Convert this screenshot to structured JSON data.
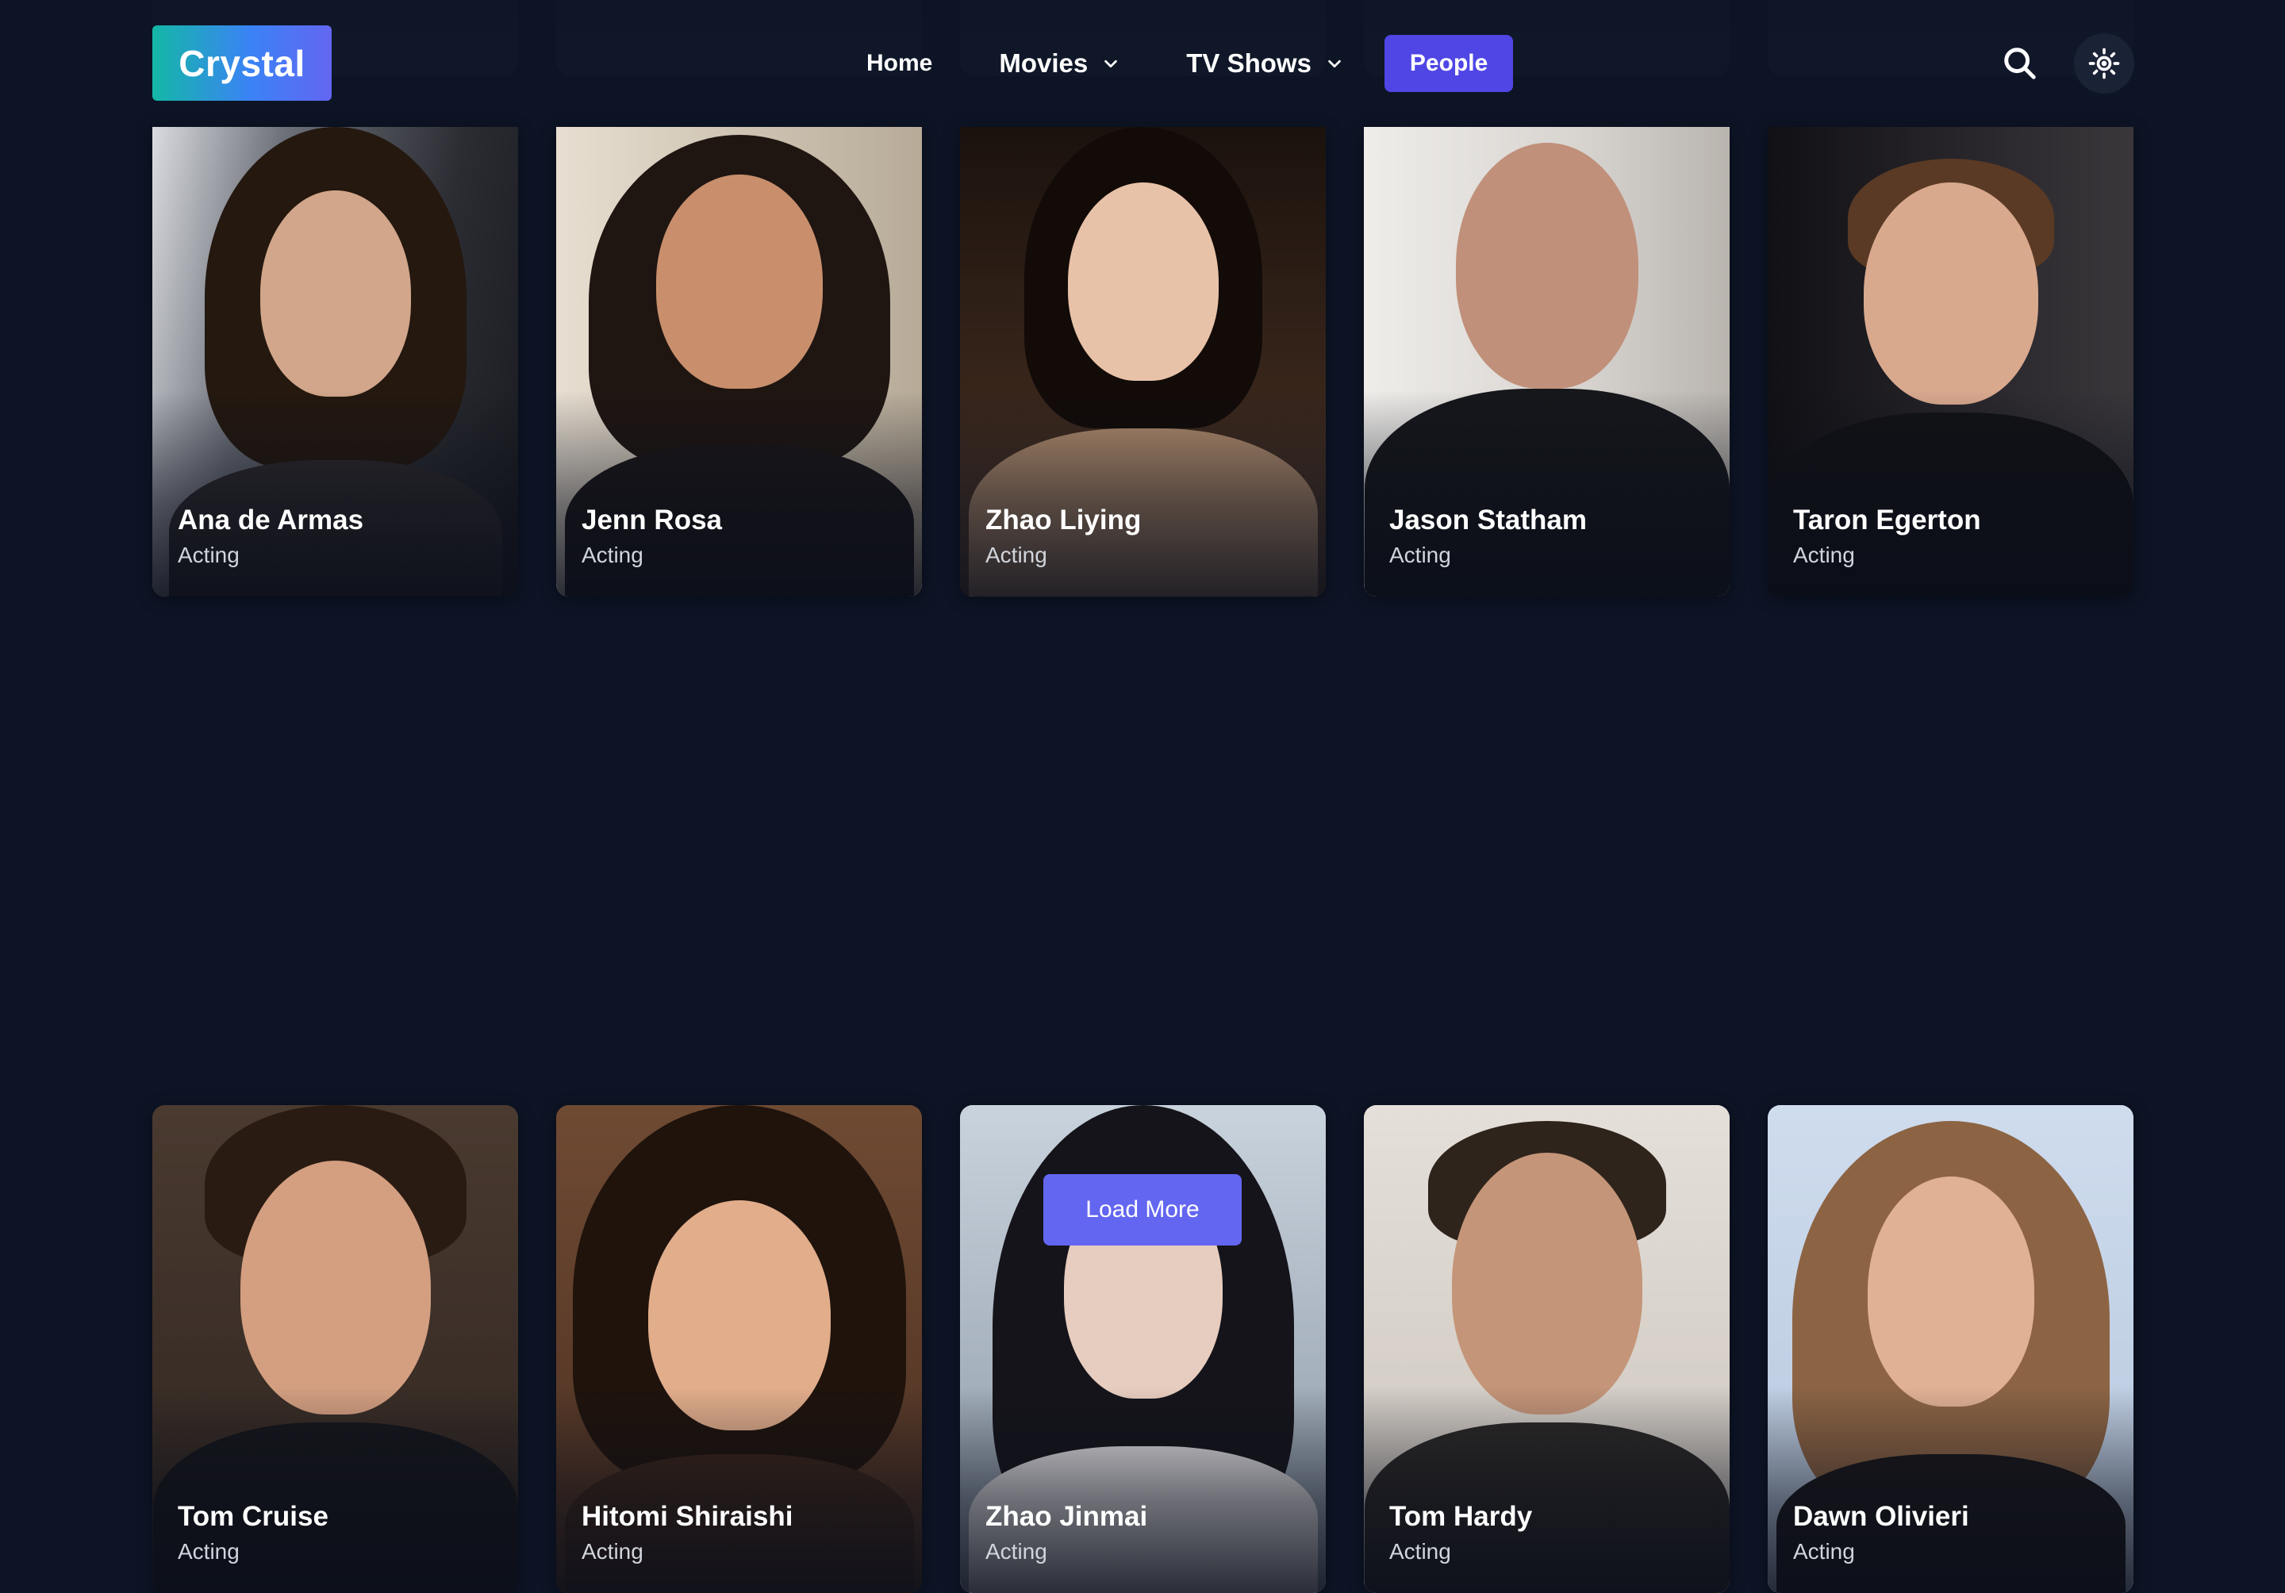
{
  "brand": {
    "logo_text": "Crystal"
  },
  "nav": {
    "home": "Home",
    "movies": "Movies",
    "tv_shows": "TV Shows",
    "people": "People",
    "active": "People"
  },
  "colors": {
    "background": "#0d1425",
    "accent": "#4f46e5",
    "button": "#6366f1"
  },
  "icons": {
    "search": "search-icon",
    "theme": "sun-icon",
    "chevron": "chevron-down-icon"
  },
  "people": [
    {
      "name": "Ana de Armas",
      "department": "Acting"
    },
    {
      "name": "Jenn Rosa",
      "department": "Acting"
    },
    {
      "name": "Zhao Liying",
      "department": "Acting"
    },
    {
      "name": "Jason Statham",
      "department": "Acting"
    },
    {
      "name": "Taron Egerton",
      "department": "Acting"
    },
    {
      "name": "Tom Cruise",
      "department": "Acting"
    },
    {
      "name": "Hitomi Shiraishi",
      "department": "Acting"
    },
    {
      "name": "Zhao Jinmai",
      "department": "Acting"
    },
    {
      "name": "Tom Hardy",
      "department": "Acting"
    },
    {
      "name": "Dawn Olivieri",
      "department": "Acting"
    }
  ],
  "load_more_label": "Load More"
}
